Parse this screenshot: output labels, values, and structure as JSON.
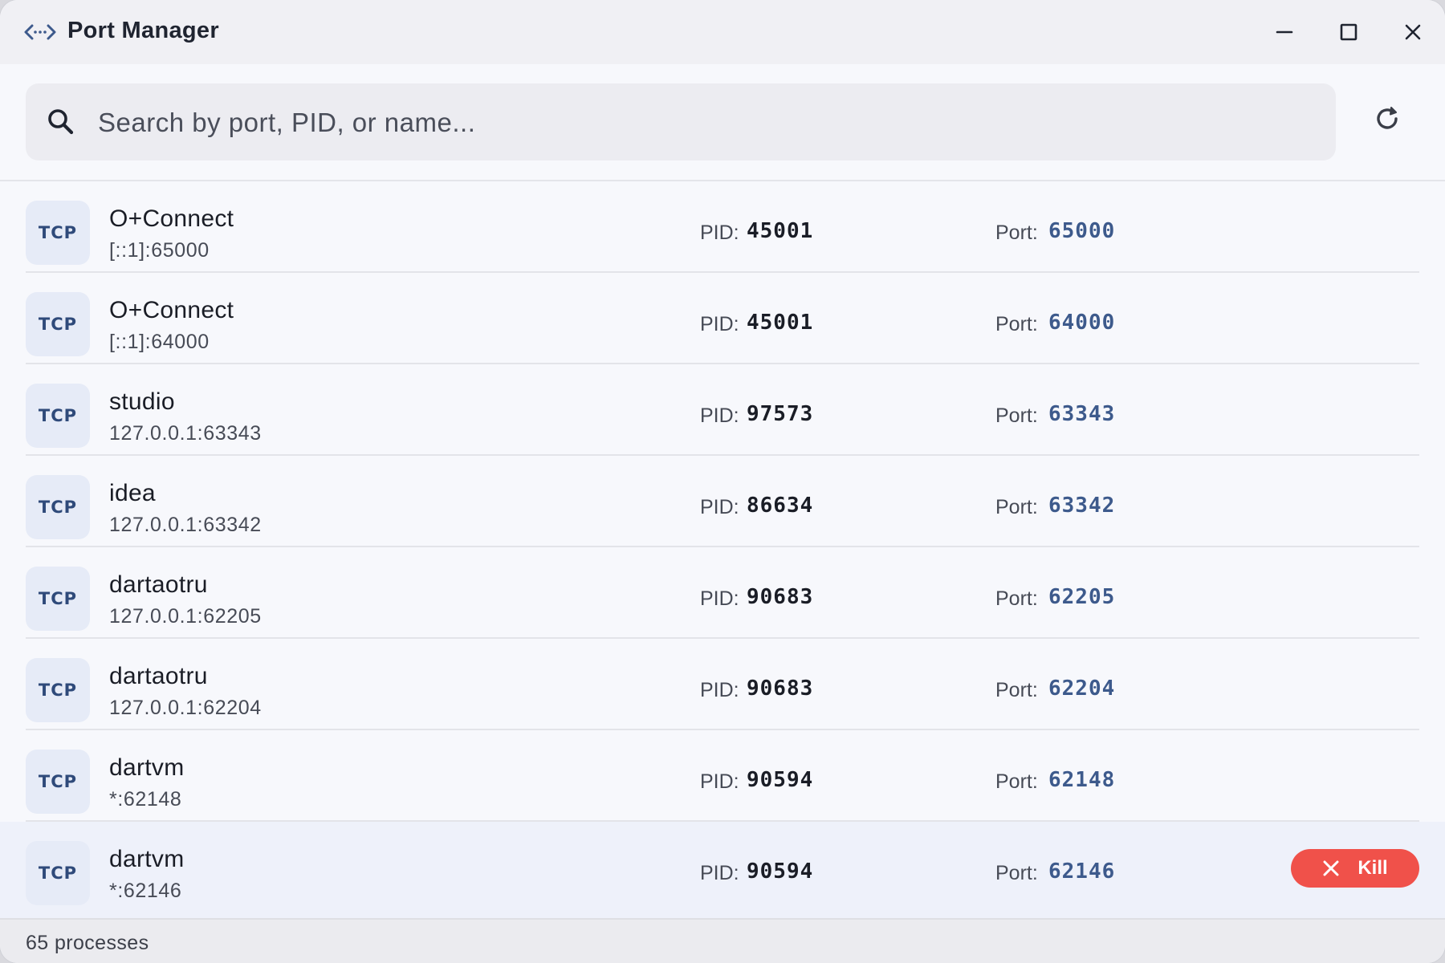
{
  "window": {
    "title": "Port Manager"
  },
  "search": {
    "placeholder": "Search by port, PID, or name...",
    "value": ""
  },
  "labels": {
    "pid": "PID:",
    "port": "Port:",
    "kill": "Kill"
  },
  "processes": [
    {
      "protocol": "TCP",
      "name": "O+Connect",
      "address": "[::1]:65000",
      "pid": "45001",
      "port": "65000"
    },
    {
      "protocol": "TCP",
      "name": "O+Connect",
      "address": "[::1]:64000",
      "pid": "45001",
      "port": "64000"
    },
    {
      "protocol": "TCP",
      "name": "studio",
      "address": "127.0.0.1:63343",
      "pid": "97573",
      "port": "63343"
    },
    {
      "protocol": "TCP",
      "name": "idea",
      "address": "127.0.0.1:63342",
      "pid": "86634",
      "port": "63342"
    },
    {
      "protocol": "TCP",
      "name": "dartaotru",
      "address": "127.0.0.1:62205",
      "pid": "90683",
      "port": "62205"
    },
    {
      "protocol": "TCP",
      "name": "dartaotru",
      "address": "127.0.0.1:62204",
      "pid": "90683",
      "port": "62204"
    },
    {
      "protocol": "TCP",
      "name": "dartvm",
      "address": "*:62148",
      "pid": "90594",
      "port": "62148"
    },
    {
      "protocol": "TCP",
      "name": "dartvm",
      "address": "*:62146",
      "pid": "90594",
      "port": "62146"
    }
  ],
  "hovered_row": 7,
  "footer": {
    "count_text": "65 processes"
  },
  "colors": {
    "accent": "#3d5a8c",
    "kill": "#f0514a",
    "badge_bg": "#e6ebf7"
  }
}
